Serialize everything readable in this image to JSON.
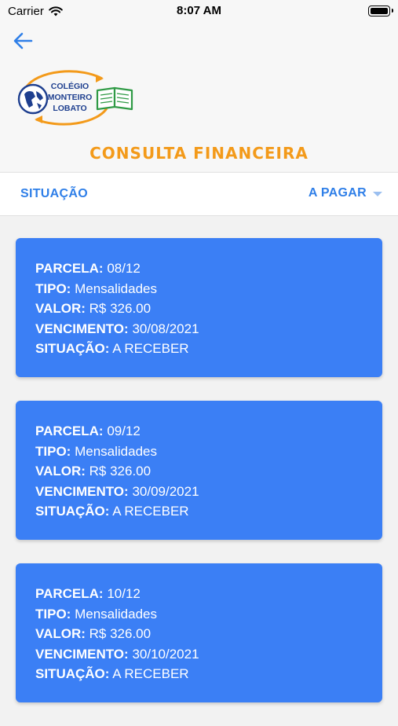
{
  "status_bar": {
    "carrier": "Carrier",
    "time": "8:07 AM"
  },
  "header": {
    "logo_text": [
      "COLÉGIO",
      "MONTEIRO",
      "LOBATO"
    ],
    "title": "CONSULTA FINANCEIRA"
  },
  "filter": {
    "label": "SITUAÇÃO",
    "value": "A PAGAR"
  },
  "labels": {
    "parcela": "PARCELA:",
    "tipo": "TIPO:",
    "valor": "VALOR:",
    "vencimento": "VENCIMENTO:",
    "situacao": "SITUAÇÃO:"
  },
  "cards": [
    {
      "parcela": "08/12",
      "tipo": "Mensalidades",
      "valor": "R$ 326.00",
      "vencimento": "30/08/2021",
      "situacao": "A RECEBER"
    },
    {
      "parcela": "09/12",
      "tipo": "Mensalidades",
      "valor": "R$ 326.00",
      "vencimento": "30/09/2021",
      "situacao": "A RECEBER"
    },
    {
      "parcela": "10/12",
      "tipo": "Mensalidades",
      "valor": "R$ 326.00",
      "vencimento": "30/10/2021",
      "situacao": "A RECEBER"
    }
  ],
  "colors": {
    "accent_blue": "#3b7ff5",
    "link_blue": "#2f7fe8",
    "title_orange": "#f39a1a",
    "logo_navy": "#1e3f8f",
    "logo_green": "#2f9a45"
  }
}
